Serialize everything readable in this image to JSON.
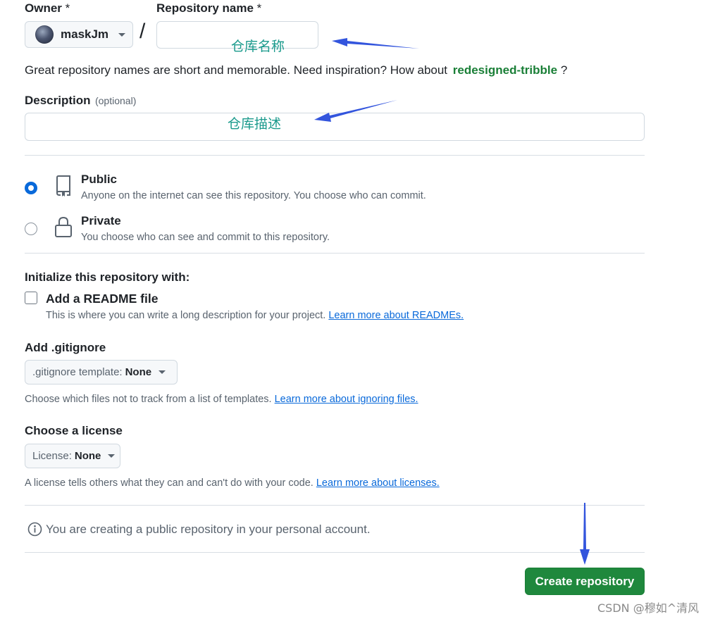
{
  "owner": {
    "label": "Owner",
    "required_mark": "*",
    "name": "maskJm"
  },
  "repo_name": {
    "label": "Repository name",
    "required_mark": "*",
    "separator": "/",
    "value": "",
    "annotation": "仓库名称"
  },
  "suggestion": {
    "text": "Great repository names are short and memorable. Need inspiration? How about",
    "name": "redesigned-tribble",
    "suffix": "?"
  },
  "description": {
    "label": "Description",
    "optional": "(optional)",
    "value": "",
    "annotation": "仓库描述"
  },
  "visibility": {
    "options": [
      {
        "title": "Public",
        "desc": "Anyone on the internet can see this repository. You choose who can commit.",
        "selected": true
      },
      {
        "title": "Private",
        "desc": "You choose who can see and commit to this repository.",
        "selected": false
      }
    ]
  },
  "init": {
    "heading": "Initialize this repository with:",
    "readme_label": "Add a README file",
    "readme_help": "This is where you can write a long description for your project.",
    "readme_link": "Learn more about READMEs."
  },
  "gitignore": {
    "heading": "Add .gitignore",
    "select_prefix": ".gitignore template:",
    "select_value": "None",
    "help": "Choose which files not to track from a list of templates.",
    "link": "Learn more about ignoring files."
  },
  "license": {
    "heading": "Choose a license",
    "select_prefix": "License:",
    "select_value": "None",
    "help": "A license tells others what they can and can't do with your code.",
    "link": "Learn more about licenses."
  },
  "notice": "You are creating a public repository in your personal account.",
  "submit_label": "Create repository",
  "watermark": "CSDN @穆如^清风",
  "colors": {
    "primary_button": "#1f883d",
    "link": "#0969da",
    "suggestion": "#1a7f37",
    "annotation_text": "#1a9a8c",
    "annotation_arrow": "#3355dd"
  }
}
